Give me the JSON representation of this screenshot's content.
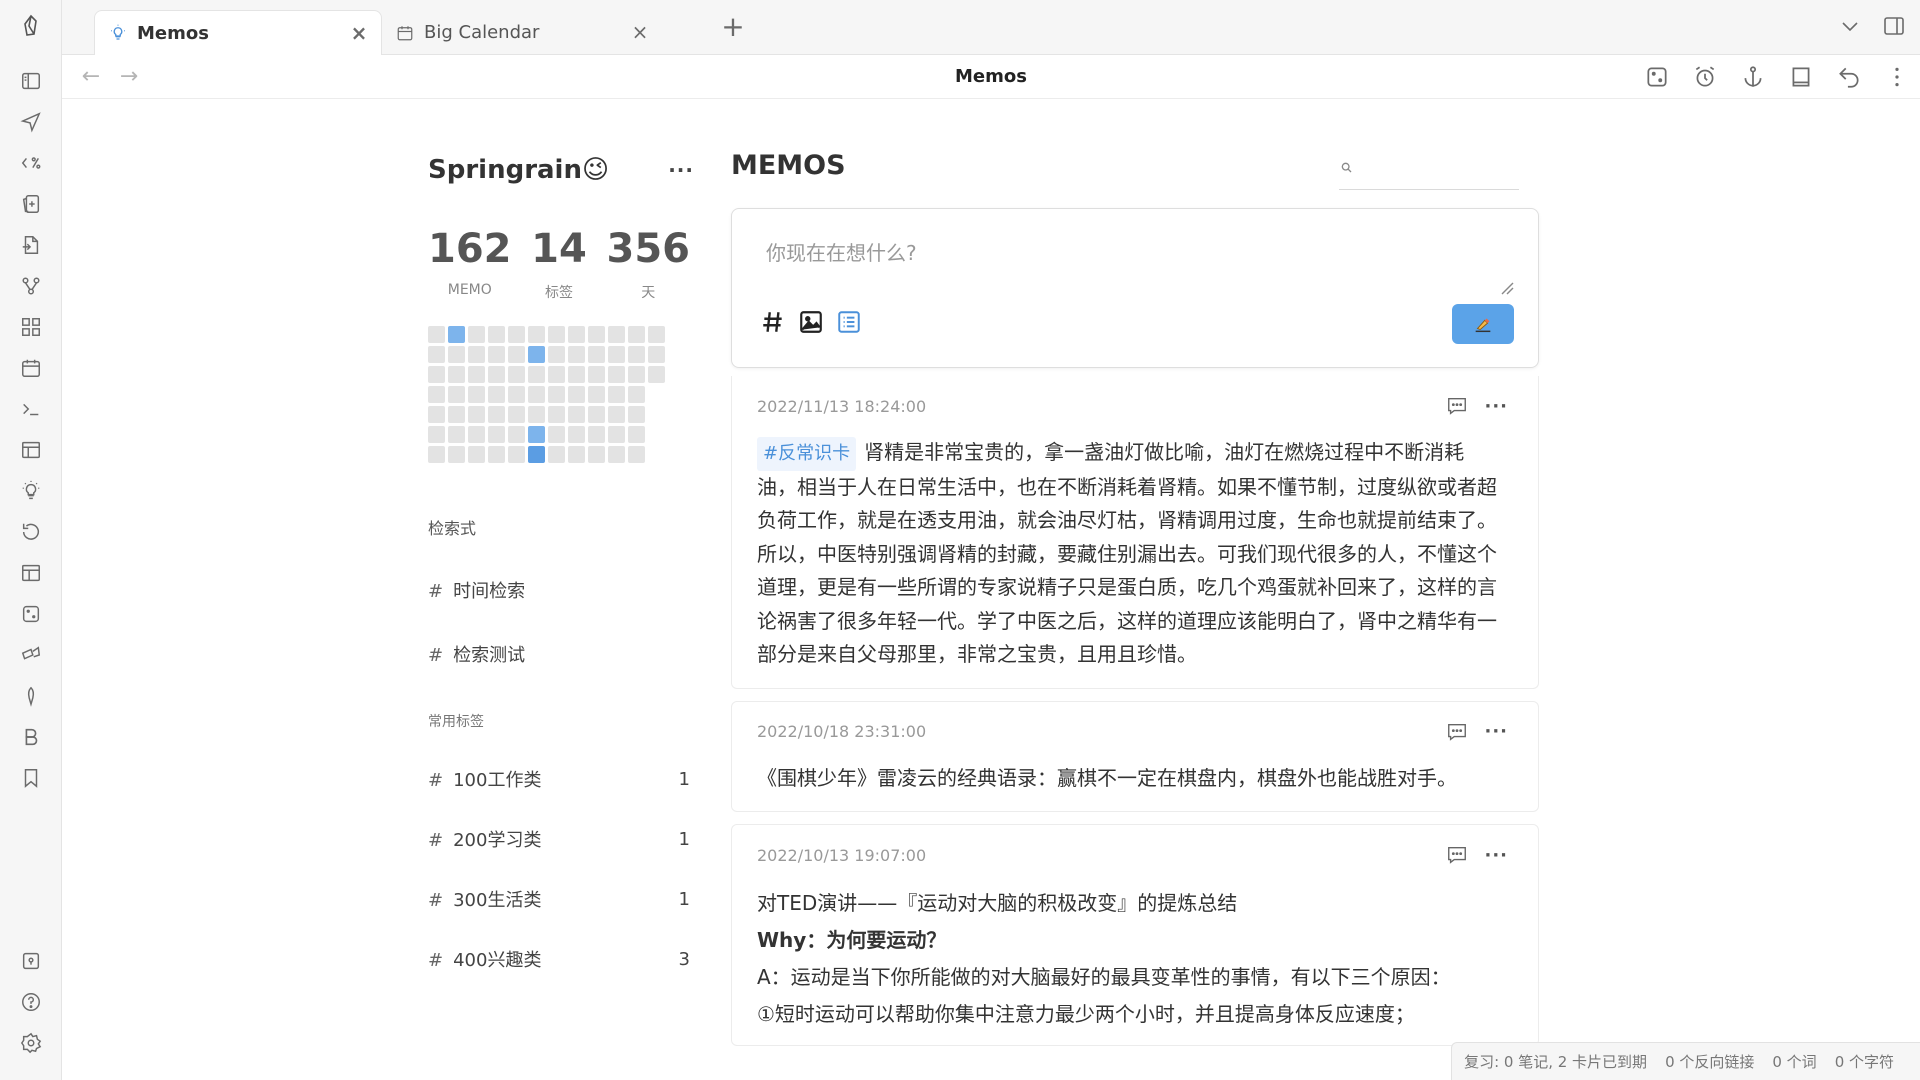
{
  "tabs": [
    {
      "label": "Memos",
      "active": true
    },
    {
      "label": "Big Calendar",
      "active": false
    }
  ],
  "nav": {
    "title": "Memos"
  },
  "profile": {
    "username": "Springrain😉",
    "stats": [
      {
        "value": "162",
        "label": "MEMO"
      },
      {
        "value": "14",
        "label": "标签"
      },
      {
        "value": "356",
        "label": "天"
      }
    ]
  },
  "heatmap": {
    "rows": [
      [
        0,
        1,
        0,
        0,
        0,
        0,
        0,
        0,
        0,
        0,
        0,
        0
      ],
      [
        0,
        0,
        0,
        0,
        0,
        1,
        0,
        0,
        0,
        0,
        0,
        0
      ],
      [
        0,
        0,
        0,
        0,
        0,
        0,
        0,
        0,
        0,
        0,
        0,
        0
      ],
      [
        0,
        0,
        0,
        0,
        0,
        0,
        0,
        0,
        0,
        0,
        0,
        -1
      ],
      [
        0,
        0,
        0,
        0,
        0,
        0,
        0,
        0,
        0,
        0,
        0,
        -1
      ],
      [
        0,
        0,
        0,
        0,
        0,
        1,
        0,
        0,
        0,
        0,
        0,
        -1
      ],
      [
        0,
        0,
        0,
        0,
        0,
        2,
        0,
        0,
        0,
        0,
        0,
        -1
      ]
    ]
  },
  "queries": {
    "title": "检索式",
    "items": [
      "时间检索",
      "检索测试"
    ]
  },
  "tags": {
    "title": "常用标签",
    "items": [
      {
        "name": "100工作类",
        "count": "1"
      },
      {
        "name": "200学习类",
        "count": "1"
      },
      {
        "name": "300生活类",
        "count": "1"
      },
      {
        "name": "400兴趣类",
        "count": "3"
      }
    ]
  },
  "main": {
    "title": "MEMOS",
    "search_placeholder": "",
    "editor_placeholder": "你现在在想什么?"
  },
  "memos": [
    {
      "date": "2022/11/13 18:24:00",
      "tag": "#反常识卡",
      "paragraphs": [
        "肾精是非常宝贵的，拿一盏油灯做比喻，油灯在燃烧过程中不断消耗油，相当于人在日常生活中，也在不断消耗着肾精。如果不懂节制，过度纵欲或者超负荷工作，就是在透支用油，就会油尽灯枯，肾精调用过度，生命也就提前结束了。",
        "所以，中医特别强调肾精的封藏，要藏住别漏出去。可我们现代很多的人，不懂这个道理，更是有一些所谓的专家说精子只是蛋白质，吃几个鸡蛋就补回来了，这样的言论祸害了很多年轻一代。学了中医之后，这样的道理应该能明白了，肾中之精华有一部分是来自父母那里，非常之宝贵，且用且珍惜。"
      ]
    },
    {
      "date": "2022/10/18 23:31:00",
      "paragraphs": [
        "《围棋少年》雷凌云的经典语录：赢棋不一定在棋盘内，棋盘外也能战胜对手。"
      ]
    },
    {
      "date": "2022/10/13 19:07:00",
      "line1": "对TED演讲——『运动对大脑的积极改变』的提炼总结",
      "line2": "Why：为何要运动？",
      "line3": "A：运动是当下你所能做的对大脑最好的最具变革性的事情，有以下三个原因：",
      "line4": "①短时运动可以帮助你集中注意力最少两个小时，并且提高身体反应速度；"
    }
  ],
  "status": {
    "review": "复习: 0 笔记, 2 卡片已到期",
    "backlinks": "0 个反向链接",
    "words": "0 个词",
    "chars": "0 个字符"
  }
}
